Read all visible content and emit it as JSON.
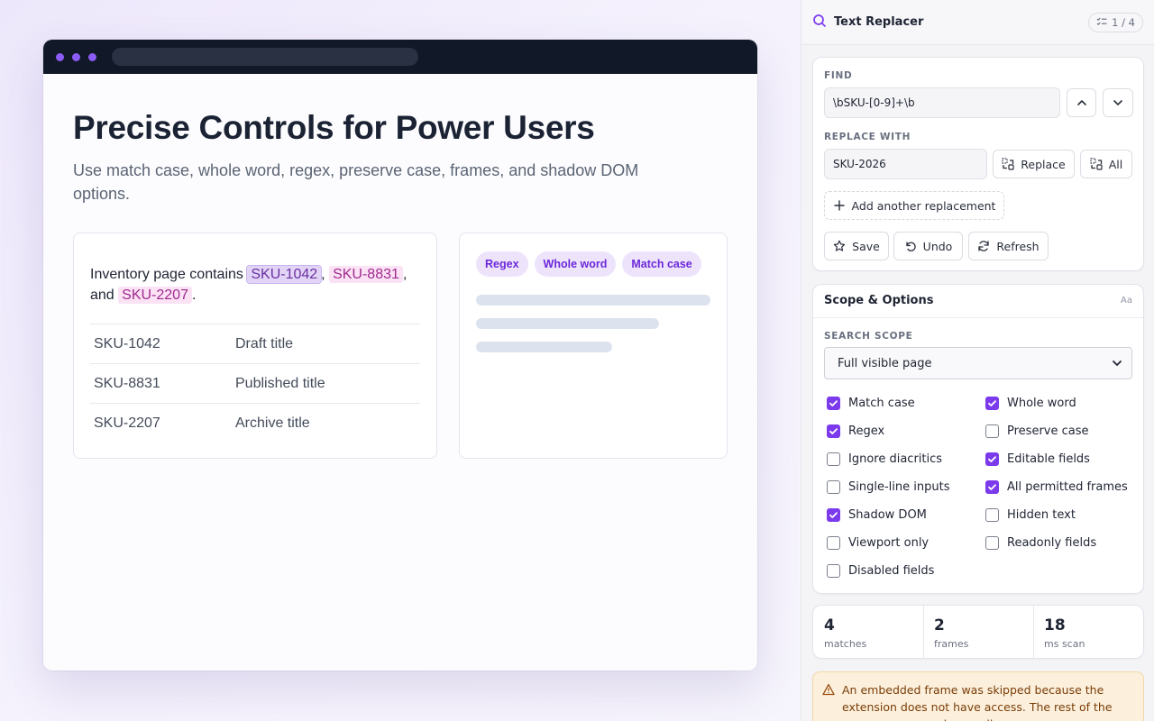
{
  "hero": {
    "title": "Precise Controls for Power Users",
    "subtitle": "Use match case, whole word, regex, preserve case, frames, and shadow DOM options."
  },
  "demo": {
    "intro": "Inventory page contains ",
    "match1": "SKU-1042",
    "sep1": ", ",
    "match2": "SKU-8831",
    "sep2": ", and ",
    "match3": "SKU-2207",
    "end": ".",
    "rows": [
      {
        "sku": "SKU-1042",
        "title": "Draft title"
      },
      {
        "sku": "SKU-8831",
        "title": "Published title"
      },
      {
        "sku": "SKU-2207",
        "title": "Archive title"
      }
    ],
    "pills": [
      "Regex",
      "Whole word",
      "Match case"
    ]
  },
  "panel": {
    "title": "Text Replacer",
    "counter": "1 / 4",
    "find_label": "FIND",
    "find_value": "\\bSKU-[0-9]+\\b",
    "replace_label": "REPLACE WITH",
    "replace_value": "SKU-2026",
    "replace_btn": "Replace",
    "all_btn": "All",
    "add_btn": "Add another replacement",
    "save_btn": "Save",
    "undo_btn": "Undo",
    "refresh_btn": "Refresh",
    "scope_title": "Scope & Options",
    "scope_badge": "Aa",
    "search_scope_label": "SEARCH SCOPE",
    "search_scope_value": "Full visible page",
    "options": [
      {
        "label": "Match case",
        "checked": true
      },
      {
        "label": "Whole word",
        "checked": true
      },
      {
        "label": "Regex",
        "checked": true
      },
      {
        "label": "Preserve case",
        "checked": false
      },
      {
        "label": "Ignore diacritics",
        "checked": false
      },
      {
        "label": "Editable fields",
        "checked": true
      },
      {
        "label": "Single-line inputs",
        "checked": false
      },
      {
        "label": "All permitted frames",
        "checked": true
      },
      {
        "label": "Shadow DOM",
        "checked": true
      },
      {
        "label": "Hidden text",
        "checked": false
      },
      {
        "label": "Viewport only",
        "checked": false
      },
      {
        "label": "Readonly fields",
        "checked": false
      },
      {
        "label": "Disabled fields",
        "checked": false
      }
    ],
    "stats": [
      {
        "value": "4",
        "unit": "matches"
      },
      {
        "value": "2",
        "unit": "frames"
      },
      {
        "value": "18",
        "unit": "ms scan"
      }
    ],
    "warning": "An embedded frame was skipped because the extension does not have access. The rest of the page was scanned normally."
  },
  "colors": {
    "accent": "#7c3aed",
    "highlight_bg": "#fbe2f5",
    "active_highlight_bg": "#e2d4f7",
    "warning_bg": "#fcf0dc",
    "chrome_bar": "#111827"
  }
}
